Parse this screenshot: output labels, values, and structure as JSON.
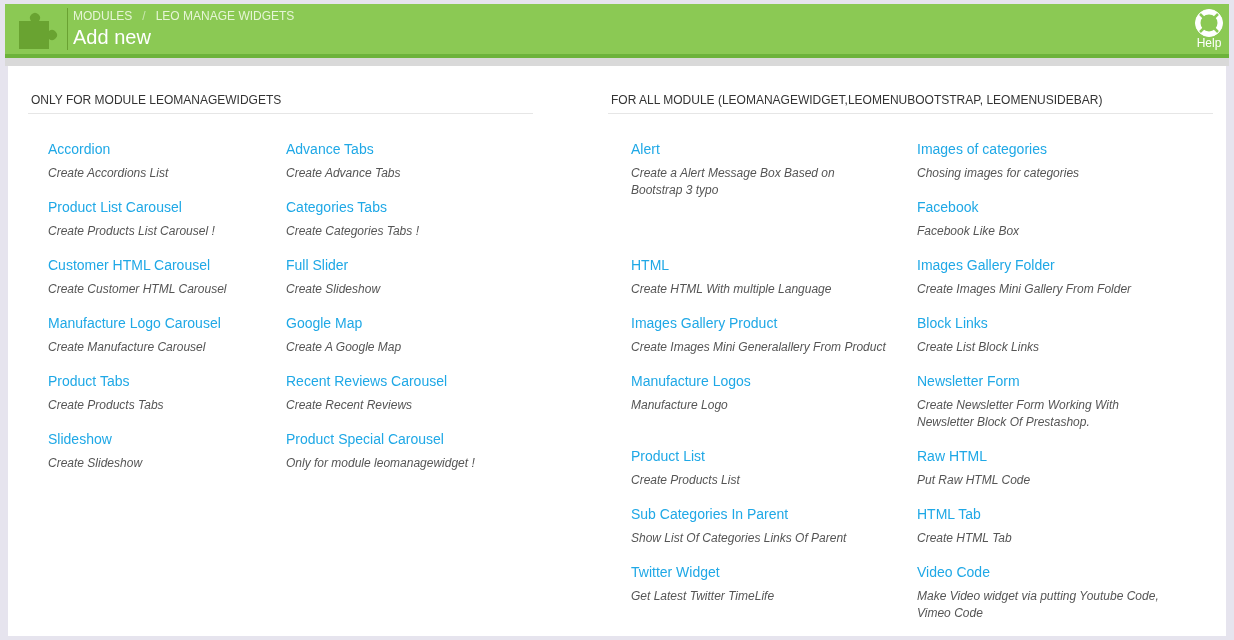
{
  "header": {
    "breadcrumb": [
      "MODULES",
      "LEO MANAGE WIDGETS"
    ],
    "separator": "/",
    "title": "Add new",
    "help": "Help"
  },
  "sections": [
    {
      "heading": "ONLY FOR MODULE LEOMANAGEWIDGETS",
      "rows": [
        [
          [
            {
              "title": "Accordion",
              "description": "Create Accordions List"
            }
          ],
          [
            {
              "title": "Advance Tabs",
              "description": "Create Advance Tabs"
            }
          ]
        ],
        [
          [
            {
              "title": "Product List Carousel",
              "description": "Create Products List Carousel !"
            }
          ],
          [
            {
              "title": "Categories Tabs",
              "description": "Create Categories Tabs !"
            }
          ]
        ],
        [
          [
            {
              "title": "Customer HTML Carousel",
              "description": "Create Customer HTML Carousel"
            }
          ],
          [
            {
              "title": "Full Slider",
              "description": "Create Slideshow"
            }
          ]
        ],
        [
          [
            {
              "title": "Manufacture Logo Carousel",
              "description": "Create Manufacture Carousel"
            }
          ],
          [
            {
              "title": "Google Map",
              "description": "Create A Google Map"
            }
          ]
        ],
        [
          [
            {
              "title": "Product Tabs",
              "description": "Create Products Tabs"
            }
          ],
          [
            {
              "title": "Recent Reviews Carousel",
              "description": "Create Recent Reviews"
            }
          ]
        ],
        [
          [
            {
              "title": "Slideshow",
              "description": "Create Slideshow"
            }
          ],
          [
            {
              "title": "Product Special Carousel",
              "description": "Only for module leomanagewidget !"
            }
          ]
        ]
      ]
    },
    {
      "heading": "FOR ALL MODULE (LEOMANAGEWIDGET,LEOMENUBOOTSTRAP, LEOMENUSIDEBAR)",
      "rows": [
        [
          [
            {
              "title": "Alert",
              "description": "Create a Alert Message Box Based on Bootstrap 3 typo"
            }
          ],
          [
            {
              "title": "Images of categories",
              "description": "Chosing images for categories"
            },
            {
              "title": "Facebook",
              "description": "Facebook Like Box"
            }
          ]
        ],
        [
          [
            {
              "title": "HTML",
              "description": "Create HTML With multiple Language"
            }
          ],
          [
            {
              "title": "Images Gallery Folder",
              "description": "Create Images Mini Gallery From Folder"
            }
          ]
        ],
        [
          [
            {
              "title": "Images Gallery Product",
              "description": "Create Images Mini Generalallery From Product"
            }
          ],
          [
            {
              "title": "Block Links",
              "description": "Create List Block Links"
            }
          ]
        ],
        [
          [
            {
              "title": "Manufacture Logos",
              "description": "Manufacture Logo"
            }
          ],
          [
            {
              "title": "Newsletter Form",
              "description": "Create Newsletter Form Working With Newsletter Block Of Prestashop."
            }
          ]
        ],
        [
          [
            {
              "title": "Product List",
              "description": "Create Products List"
            }
          ],
          [
            {
              "title": "Raw HTML",
              "description": "Put Raw HTML Code"
            }
          ]
        ],
        [
          [
            {
              "title": "Sub Categories In Parent",
              "description": "Show List Of Categories Links Of Parent"
            }
          ],
          [
            {
              "title": "HTML Tab",
              "description": "Create HTML Tab"
            }
          ]
        ],
        [
          [
            {
              "title": "Twitter Widget",
              "description": "Get Latest Twitter TimeLife"
            }
          ],
          [
            {
              "title": "Video Code",
              "description": "Make Video widget via putting Youtube Code, Vimeo Code"
            }
          ]
        ]
      ]
    }
  ]
}
